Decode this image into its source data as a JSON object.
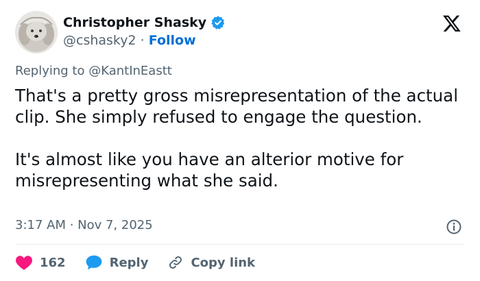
{
  "author": {
    "name": "Christopher Shasky",
    "handle": "@cshasky2",
    "separator": "·",
    "follow_label": "Follow",
    "verified": true
  },
  "colors": {
    "verified_blue": "#1d9bf0",
    "follow_blue": "#006fd6",
    "like_red": "#f91880",
    "reply_blue": "#1d9bf0",
    "muted_gray": "#536471",
    "text": "#0f1419"
  },
  "reply_context": {
    "prefix": "Replying to",
    "handle": "@KantInEastt"
  },
  "tweet": {
    "paragraphs": [
      "That's a pretty gross misrepresentation of the actual clip. She simply refused to engage the question.",
      "It's almost like you have an alterior motive for misrepresenting what she said."
    ],
    "timestamp": "3:17 AM · Nov 7, 2025"
  },
  "actions": {
    "likes": "162",
    "reply_label": "Reply",
    "copy_link_label": "Copy link"
  },
  "icons": {
    "brand": "x-logo-icon",
    "verified": "verified-badge-icon",
    "info": "info-icon",
    "like": "heart-icon",
    "reply": "speech-bubble-icon",
    "copy": "link-icon"
  }
}
